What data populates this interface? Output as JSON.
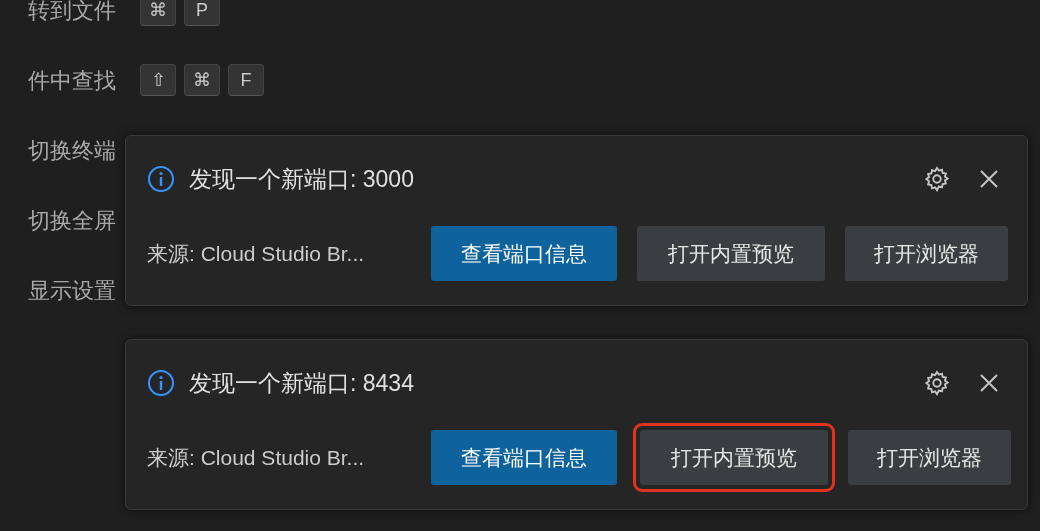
{
  "shortcuts": [
    {
      "label": "转到文件",
      "keys": [
        "⌘",
        "P"
      ]
    },
    {
      "label": "件中查找",
      "keys": [
        "⇧",
        "⌘",
        "F"
      ]
    },
    {
      "label": "切换终端"
    },
    {
      "label": "切换全屏"
    },
    {
      "label": "显示设置"
    }
  ],
  "notifications": [
    {
      "title": "发现一个新端口: 3000",
      "source": "来源: Cloud Studio Br...",
      "buttons": [
        {
          "label": "查看端口信息",
          "kind": "primary",
          "highlighted": false
        },
        {
          "label": "打开内置预览",
          "kind": "secondary",
          "highlighted": false
        },
        {
          "label": "打开浏览器",
          "kind": "secondary",
          "highlighted": false
        }
      ]
    },
    {
      "title": "发现一个新端口: 8434",
      "source": "来源: Cloud Studio Br...",
      "buttons": [
        {
          "label": "查看端口信息",
          "kind": "primary",
          "highlighted": false
        },
        {
          "label": "打开内置预览",
          "kind": "secondary",
          "highlighted": true
        },
        {
          "label": "打开浏览器",
          "kind": "secondary",
          "highlighted": false
        }
      ]
    }
  ]
}
